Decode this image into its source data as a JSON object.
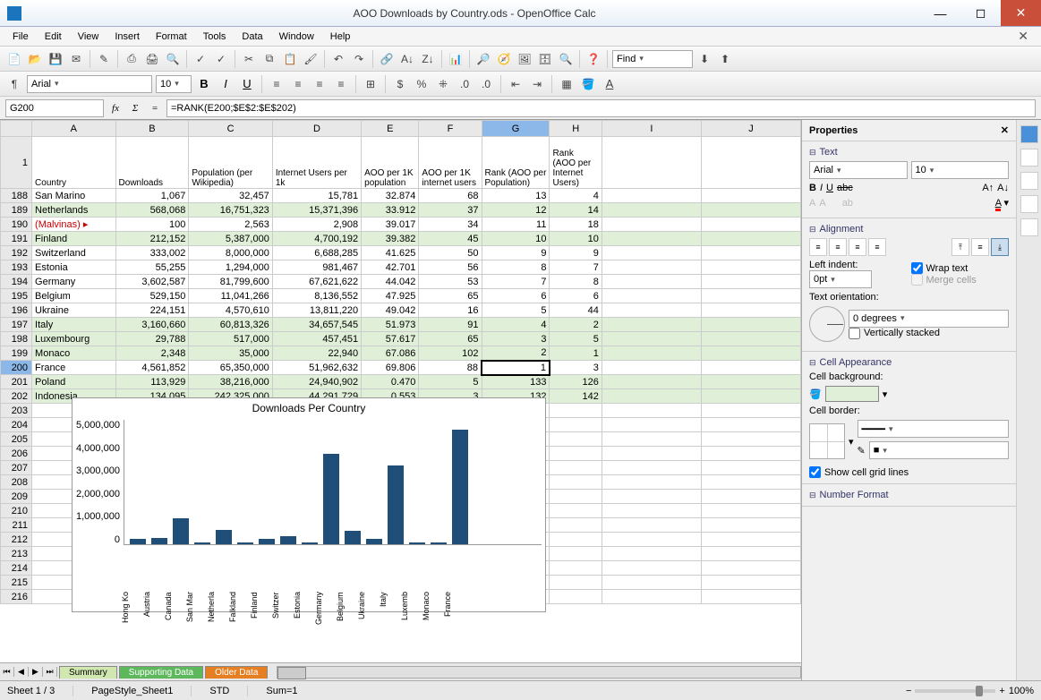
{
  "window": {
    "title": "AOO Downloads by Country.ods - OpenOffice Calc"
  },
  "menu": [
    "File",
    "Edit",
    "View",
    "Insert",
    "Format",
    "Tools",
    "Data",
    "Window",
    "Help"
  ],
  "find_placeholder": "Find",
  "format": {
    "font": "Arial",
    "size": "10"
  },
  "formula": {
    "cellref": "G200",
    "value": "=RANK(E200;$E$2:$E$202)"
  },
  "columns": [
    "A",
    "B",
    "C",
    "D",
    "E",
    "F",
    "G",
    "H",
    "I",
    "J"
  ],
  "header_row": {
    "num": "1",
    "cells": [
      "Country",
      "Downloads",
      "Population (per Wikipedia)",
      "Internet Users per 1k",
      "AOO per 1K population",
      "AOO per 1K internet users",
      "Rank (AOO per Population)",
      "Rank (AOO per Internet Users)",
      "",
      ""
    ]
  },
  "rows": [
    {
      "n": 188,
      "c": [
        "San Marino",
        "1,067",
        "32,457",
        "15,781",
        "32.874",
        "68",
        "13",
        "4",
        "",
        ""
      ]
    },
    {
      "n": 189,
      "s": true,
      "c": [
        "Netherlands",
        "568,068",
        "16,751,323",
        "15,371,396",
        "33.912",
        "37",
        "12",
        "14",
        "",
        ""
      ]
    },
    {
      "n": 190,
      "red": true,
      "ind": true,
      "c": [
        "(Malvinas)",
        "100",
        "2,563",
        "2,908",
        "39.017",
        "34",
        "11",
        "18",
        "",
        ""
      ]
    },
    {
      "n": 191,
      "s": true,
      "c": [
        "Finland",
        "212,152",
        "5,387,000",
        "4,700,192",
        "39.382",
        "45",
        "10",
        "10",
        "",
        ""
      ]
    },
    {
      "n": 192,
      "c": [
        "Switzerland",
        "333,002",
        "8,000,000",
        "6,688,285",
        "41.625",
        "50",
        "9",
        "9",
        "",
        ""
      ]
    },
    {
      "n": 193,
      "c": [
        "Estonia",
        "55,255",
        "1,294,000",
        "981,467",
        "42.701",
        "56",
        "8",
        "7",
        "",
        ""
      ]
    },
    {
      "n": 194,
      "c": [
        "Germany",
        "3,602,587",
        "81,799,600",
        "67,621,622",
        "44.042",
        "53",
        "7",
        "8",
        "",
        ""
      ]
    },
    {
      "n": 195,
      "c": [
        "Belgium",
        "529,150",
        "11,041,266",
        "8,136,552",
        "47.925",
        "65",
        "6",
        "6",
        "",
        ""
      ]
    },
    {
      "n": 196,
      "c": [
        "Ukraine",
        "224,151",
        "4,570,610",
        "13,811,220",
        "49.042",
        "16",
        "5",
        "44",
        "",
        ""
      ]
    },
    {
      "n": 197,
      "s": true,
      "c": [
        "Italy",
        "3,160,660",
        "60,813,326",
        "34,657,545",
        "51.973",
        "91",
        "4",
        "2",
        "",
        ""
      ]
    },
    {
      "n": 198,
      "s": true,
      "c": [
        "Luxembourg",
        "29,788",
        "517,000",
        "457,451",
        "57.617",
        "65",
        "3",
        "5",
        "",
        ""
      ]
    },
    {
      "n": 199,
      "s": true,
      "c": [
        "Monaco",
        "2,348",
        "35,000",
        "22,940",
        "67.086",
        "102",
        "2",
        "1",
        "",
        ""
      ]
    },
    {
      "n": 200,
      "sel": true,
      "c": [
        "France",
        "4,561,852",
        "65,350,000",
        "51,962,632",
        "69.806",
        "88",
        "1",
        "3",
        "",
        ""
      ]
    },
    {
      "n": 201,
      "s": true,
      "c": [
        "Poland",
        "113,929",
        "38,216,000",
        "24,940,902",
        "0.470",
        "5",
        "133",
        "126",
        "",
        ""
      ]
    },
    {
      "n": 202,
      "s": true,
      "c": [
        "Indonesia",
        "134,095",
        "242,325,000",
        "44,291,729",
        "0.553",
        "3",
        "132",
        "142",
        "",
        ""
      ]
    },
    {
      "n": 203,
      "c": [
        "",
        "",
        "",
        "",
        "",
        "",
        "",
        "",
        "",
        ""
      ]
    },
    {
      "n": 204,
      "c": [
        "",
        "",
        "",
        "",
        "",
        "",
        "",
        "",
        "",
        ""
      ]
    },
    {
      "n": 205,
      "c": [
        "",
        "",
        "",
        "",
        "",
        "",
        "",
        "",
        "",
        ""
      ]
    },
    {
      "n": 206,
      "c": [
        "",
        "",
        "",
        "",
        "",
        "",
        "",
        "",
        "",
        ""
      ]
    },
    {
      "n": 207,
      "c": [
        "",
        "",
        "",
        "",
        "",
        "",
        "",
        "",
        "",
        ""
      ]
    },
    {
      "n": 208,
      "c": [
        "",
        "",
        "",
        "",
        "",
        "",
        "",
        "",
        "",
        ""
      ]
    },
    {
      "n": 209,
      "c": [
        "",
        "",
        "",
        "",
        "",
        "",
        "",
        "",
        "",
        ""
      ]
    },
    {
      "n": 210,
      "c": [
        "",
        "",
        "",
        "",
        "",
        "",
        "",
        "",
        "",
        ""
      ]
    },
    {
      "n": 211,
      "c": [
        "",
        "",
        "",
        "",
        "",
        "",
        "",
        "",
        "",
        ""
      ]
    },
    {
      "n": 212,
      "c": [
        "",
        "",
        "",
        "",
        "",
        "",
        "",
        "",
        "",
        ""
      ]
    },
    {
      "n": 213,
      "c": [
        "",
        "",
        "",
        "",
        "",
        "",
        "",
        "",
        "",
        ""
      ]
    },
    {
      "n": 214,
      "c": [
        "",
        "",
        "",
        "",
        "",
        "",
        "",
        "",
        "",
        ""
      ]
    },
    {
      "n": 215,
      "c": [
        "",
        "",
        "",
        "",
        "",
        "",
        "",
        "",
        "",
        ""
      ]
    },
    {
      "n": 216,
      "c": [
        "",
        "",
        "",
        "",
        "",
        "",
        "",
        "",
        "",
        ""
      ]
    }
  ],
  "chart_data": {
    "type": "bar",
    "title": "Downloads Per Country",
    "ylim": [
      0,
      5000000
    ],
    "yticks": [
      "5,000,000",
      "4,000,000",
      "3,000,000",
      "2,000,000",
      "1,000,000",
      "0"
    ],
    "categories": [
      "Hong Ko",
      "Austria",
      "Canada",
      "San Mar",
      "Netherla",
      "Falkland",
      "Finland",
      "Switzer",
      "Estonia",
      "Germany",
      "Belgium",
      "Ukraine",
      "Italy",
      "Luxemb",
      "Monaco",
      "France"
    ],
    "values": [
      200000,
      250000,
      1050000,
      1067,
      568068,
      100,
      212152,
      333002,
      55255,
      3602587,
      529150,
      224151,
      3160660,
      29788,
      2348,
      4561852
    ]
  },
  "tabs": [
    "Summary",
    "Supporting Data",
    "Older Data"
  ],
  "status": {
    "sheet": "Sheet 1 / 3",
    "style": "PageStyle_Sheet1",
    "mode": "STD",
    "sum": "Sum=1",
    "zoom": "100%"
  },
  "sidebar": {
    "title": "Properties",
    "text": {
      "h": "Text",
      "font": "Arial",
      "size": "10"
    },
    "align": {
      "h": "Alignment",
      "indent_label": "Left indent:",
      "indent": "0pt",
      "wrap": "Wrap text",
      "merge": "Merge cells",
      "orient_label": "Text orientation:",
      "degrees": "0 degrees",
      "vstack": "Vertically stacked"
    },
    "cell": {
      "h": "Cell Appearance",
      "bg": "Cell background:",
      "border": "Cell border:",
      "grid": "Show cell grid lines"
    },
    "number": {
      "h": "Number Format"
    }
  }
}
